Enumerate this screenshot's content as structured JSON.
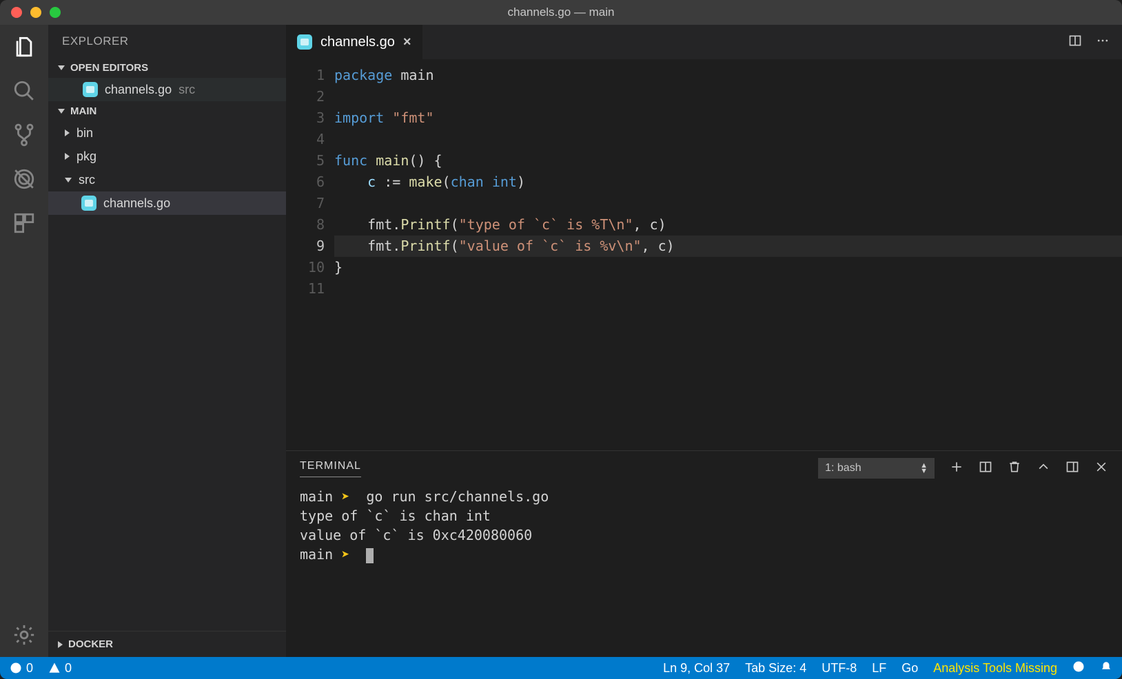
{
  "window": {
    "title": "channels.go — main"
  },
  "activity": {
    "items": [
      {
        "name": "explorer",
        "active": true
      },
      {
        "name": "search",
        "active": false
      },
      {
        "name": "source-control",
        "active": false
      },
      {
        "name": "debug",
        "active": false
      },
      {
        "name": "extensions",
        "active": false
      }
    ]
  },
  "sidebar": {
    "title": "EXPLORER",
    "open_editors": {
      "label": "OPEN EDITORS",
      "items": [
        {
          "name": "channels.go",
          "dir": "src"
        }
      ]
    },
    "workspace": {
      "label": "MAIN",
      "tree": [
        {
          "type": "folder",
          "name": "bin",
          "expanded": false
        },
        {
          "type": "folder",
          "name": "pkg",
          "expanded": false
        },
        {
          "type": "folder",
          "name": "src",
          "expanded": true,
          "children": [
            {
              "type": "file",
              "name": "channels.go",
              "selected": true
            }
          ]
        }
      ]
    },
    "docker": {
      "label": "DOCKER"
    }
  },
  "tabs": {
    "open": [
      {
        "name": "channels.go",
        "active": true
      }
    ]
  },
  "editor": {
    "language": "go",
    "active_line": 9,
    "lines": [
      {
        "n": 1,
        "tokens": [
          {
            "t": "package ",
            "c": "kw"
          },
          {
            "t": "main",
            "c": "pkg"
          }
        ]
      },
      {
        "n": 2,
        "tokens": []
      },
      {
        "n": 3,
        "tokens": [
          {
            "t": "import ",
            "c": "kw"
          },
          {
            "t": "\"fmt\"",
            "c": "str"
          }
        ]
      },
      {
        "n": 4,
        "tokens": []
      },
      {
        "n": 5,
        "tokens": [
          {
            "t": "func ",
            "c": "kw"
          },
          {
            "t": "main",
            "c": "fnname"
          },
          {
            "t": "() {",
            "c": "op"
          }
        ]
      },
      {
        "n": 6,
        "tokens": [
          {
            "t": "    c ",
            "c": "ident"
          },
          {
            "t": ":= ",
            "c": "op"
          },
          {
            "t": "make",
            "c": "fnname"
          },
          {
            "t": "(",
            "c": "op"
          },
          {
            "t": "chan ",
            "c": "type"
          },
          {
            "t": "int",
            "c": "type"
          },
          {
            "t": ")",
            "c": "op"
          }
        ]
      },
      {
        "n": 7,
        "tokens": []
      },
      {
        "n": 8,
        "tokens": [
          {
            "t": "    fmt.",
            "c": "pkg"
          },
          {
            "t": "Printf",
            "c": "fnname"
          },
          {
            "t": "(",
            "c": "op"
          },
          {
            "t": "\"type of `c` is %T\\n\"",
            "c": "str"
          },
          {
            "t": ", c)",
            "c": "op"
          }
        ]
      },
      {
        "n": 9,
        "tokens": [
          {
            "t": "    fmt.",
            "c": "pkg"
          },
          {
            "t": "Printf",
            "c": "fnname"
          },
          {
            "t": "(",
            "c": "op"
          },
          {
            "t": "\"value of `c` is %v\\n\"",
            "c": "str"
          },
          {
            "t": ", c)",
            "c": "op"
          }
        ]
      },
      {
        "n": 10,
        "tokens": [
          {
            "t": "}",
            "c": "op"
          }
        ]
      },
      {
        "n": 11,
        "tokens": []
      }
    ]
  },
  "panel": {
    "tab": "TERMINAL",
    "shell_selector": "1: bash",
    "output": [
      {
        "kind": "prompt",
        "cwd": "main",
        "cmd": "go run src/channels.go"
      },
      {
        "kind": "out",
        "text": "type of `c` is chan int"
      },
      {
        "kind": "out",
        "text": "value of `c` is 0xc420080060"
      },
      {
        "kind": "prompt",
        "cwd": "main",
        "cmd": ""
      }
    ]
  },
  "status": {
    "errors": "0",
    "warnings": "0",
    "cursor": "Ln 9, Col 37",
    "tabsize": "Tab Size: 4",
    "encoding": "UTF-8",
    "eol": "LF",
    "language": "Go",
    "warn_msg": "Analysis Tools Missing"
  }
}
